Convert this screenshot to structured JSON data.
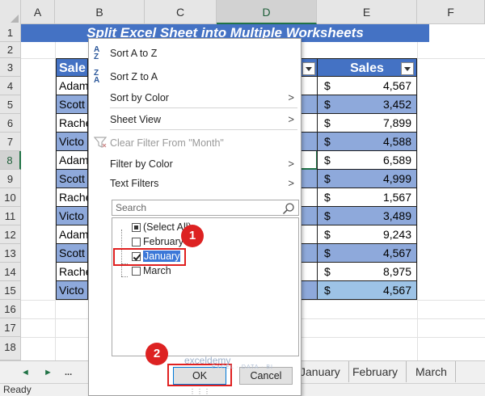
{
  "columns": [
    "A",
    "B",
    "C",
    "D",
    "E",
    "F"
  ],
  "rows": [
    "1",
    "2",
    "3",
    "4",
    "5",
    "6",
    "7",
    "8",
    "9",
    "10",
    "11",
    "12",
    "13",
    "14",
    "15",
    "16",
    "17",
    "18"
  ],
  "title": "Split Excel Sheet into Multiple Worksheets",
  "table": {
    "header_name": "Sale",
    "header_sales": "Sales",
    "names": [
      "Adam",
      "Scott",
      "Rache",
      "Victo",
      "Adam",
      "Scott",
      "Rache",
      "Victo",
      "Adam",
      "Scott",
      "Rache",
      "Victo"
    ],
    "currency": "$",
    "sales": [
      "4,567",
      "3,452",
      "7,899",
      "4,588",
      "6,589",
      "4,999",
      "1,567",
      "3,489",
      "9,243",
      "4,567",
      "8,975",
      "4,567"
    ]
  },
  "dropdown": {
    "sort_az": "Sort A to Z",
    "sort_za": "Sort Z to A",
    "sort_by_color": "Sort by Color",
    "sheet_view": "Sheet View",
    "clear_filter": "Clear Filter From \"Month\"",
    "filter_by_color": "Filter by Color",
    "text_filters": "Text Filters",
    "search_placeholder": "Search",
    "options": {
      "select_all": "(Select All)",
      "february": "February",
      "january": "January",
      "march": "March"
    },
    "ok": "OK",
    "cancel": "Cancel"
  },
  "icons": {
    "sort_az_top": "A",
    "sort_az_bottom": "Z",
    "sort_za_top": "Z",
    "sort_za_bottom": "A",
    "submenu_arrow": ">"
  },
  "badges": [
    "1",
    "2"
  ],
  "watermark": {
    "brand": "exceldemy",
    "tagline": "EXCEL · DATA · BI"
  },
  "tabs": {
    "nav_prev": "◄",
    "nav_next": "►",
    "ellipsis": "...",
    "sheets": [
      "January",
      "February",
      "March"
    ]
  },
  "status": "Ready",
  "colors": {
    "accent_header": "#4472c4",
    "band": "#8ea9db",
    "highlight": "#e02020"
  }
}
